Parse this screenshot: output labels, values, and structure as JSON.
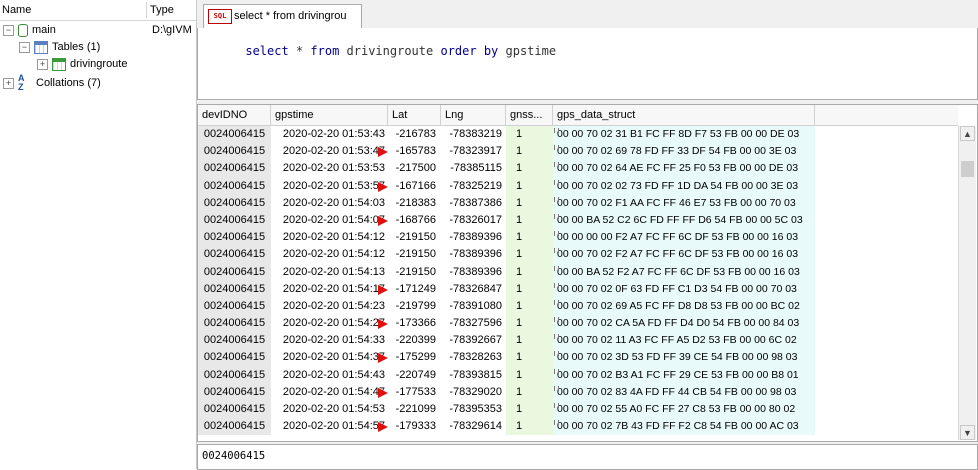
{
  "tree": {
    "header": {
      "name": "Name",
      "type": "Type"
    },
    "items": [
      {
        "label": "main",
        "type": "D:\\gIVM"
      },
      {
        "label": "Tables (1)"
      },
      {
        "label": "drivingroute"
      },
      {
        "label": "Collations (7)"
      }
    ]
  },
  "tab": {
    "label": "select * from drivingrou",
    "icon": "sql-icon"
  },
  "editor": {
    "tokens": [
      {
        "t": "select",
        "kw": true
      },
      {
        "t": " * ",
        "kw": false
      },
      {
        "t": "from",
        "kw": true
      },
      {
        "t": " drivingroute ",
        "kw": false
      },
      {
        "t": "order",
        "kw": true
      },
      {
        "t": " ",
        "kw": false
      },
      {
        "t": "by",
        "kw": true
      },
      {
        "t": " gpstime",
        "kw": false
      }
    ]
  },
  "grid": {
    "columns": [
      "devIDNO",
      "gpstime",
      "Lat",
      "Lng",
      "gnss...",
      "gps_data_struct"
    ],
    "rows": [
      {
        "dev": "0024006415",
        "time": "2020-02-20 01:53:43",
        "lat": "-216783",
        "lng": "-78383219",
        "gnss": "1",
        "data": "00 00 70 02 31 B1 FC FF 8D F7 53 FB 00 00 DE 03",
        "arrow": false
      },
      {
        "dev": "0024006415",
        "time": "2020-02-20 01:53:47",
        "lat": "-165783",
        "lng": "-78323917",
        "gnss": "1",
        "data": "00 00 70 02 69 78 FD FF 33 DF 54 FB 00 00 3E 03",
        "arrow": true
      },
      {
        "dev": "0024006415",
        "time": "2020-02-20 01:53:53",
        "lat": "-217500",
        "lng": "-78385115",
        "gnss": "1",
        "data": "00 00 70 02 64 AE FC FF 25 F0 53 FB 00 00 DE 03",
        "arrow": false
      },
      {
        "dev": "0024006415",
        "time": "2020-02-20 01:53:57",
        "lat": "-167166",
        "lng": "-78325219",
        "gnss": "1",
        "data": "00 00 70 02 02 73 FD FF 1D DA 54 FB 00 00 3E 03",
        "arrow": true
      },
      {
        "dev": "0024006415",
        "time": "2020-02-20 01:54:03",
        "lat": "-218383",
        "lng": "-78387386",
        "gnss": "1",
        "data": "00 00 70 02 F1 AA FC FF 46 E7 53 FB 00 00 70 03",
        "arrow": false
      },
      {
        "dev": "0024006415",
        "time": "2020-02-20 01:54:07",
        "lat": "-168766",
        "lng": "-78326017",
        "gnss": "1",
        "data": "00 00 BA 52 C2 6C FD FF FF D6 54 FB 00 00 5C 03",
        "arrow": true
      },
      {
        "dev": "0024006415",
        "time": "2020-02-20 01:54:12",
        "lat": "-219150",
        "lng": "-78389396",
        "gnss": "1",
        "data": "00 00 00 00 F2 A7 FC FF 6C DF 53 FB 00 00 16 03",
        "arrow": false
      },
      {
        "dev": "0024006415",
        "time": "2020-02-20 01:54:12",
        "lat": "-219150",
        "lng": "-78389396",
        "gnss": "1",
        "data": "00 00 70 02 F2 A7 FC FF 6C DF 53 FB 00 00 16 03",
        "arrow": false
      },
      {
        "dev": "0024006415",
        "time": "2020-02-20 01:54:13",
        "lat": "-219150",
        "lng": "-78389396",
        "gnss": "1",
        "data": "00 00 BA 52 F2 A7 FC FF 6C DF 53 FB 00 00 16 03",
        "arrow": false
      },
      {
        "dev": "0024006415",
        "time": "2020-02-20 01:54:17",
        "lat": "-171249",
        "lng": "-78326847",
        "gnss": "1",
        "data": "00 00 70 02 0F 63 FD FF C1 D3 54 FB 00 00 70 03",
        "arrow": true
      },
      {
        "dev": "0024006415",
        "time": "2020-02-20 01:54:23",
        "lat": "-219799",
        "lng": "-78391080",
        "gnss": "1",
        "data": "00 00 70 02 69 A5 FC FF D8 D8 53 FB 00 00 BC 02",
        "arrow": false
      },
      {
        "dev": "0024006415",
        "time": "2020-02-20 01:54:27",
        "lat": "-173366",
        "lng": "-78327596",
        "gnss": "1",
        "data": "00 00 70 02 CA 5A FD FF D4 D0 54 FB 00 00 84 03",
        "arrow": true
      },
      {
        "dev": "0024006415",
        "time": "2020-02-20 01:54:33",
        "lat": "-220399",
        "lng": "-78392667",
        "gnss": "1",
        "data": "00 00 70 02 11 A3 FC FF A5 D2 53 FB 00 00 6C 02",
        "arrow": false
      },
      {
        "dev": "0024006415",
        "time": "2020-02-20 01:54:37",
        "lat": "-175299",
        "lng": "-78328263",
        "gnss": "1",
        "data": "00 00 70 02 3D 53 FD FF 39 CE 54 FB 00 00 98 03",
        "arrow": true
      },
      {
        "dev": "0024006415",
        "time": "2020-02-20 01:54:43",
        "lat": "-220749",
        "lng": "-78393815",
        "gnss": "1",
        "data": "00 00 70 02 B3 A1 FC FF 29 CE 53 FB 00 00 B8 01",
        "arrow": false
      },
      {
        "dev": "0024006415",
        "time": "2020-02-20 01:54:47",
        "lat": "-177533",
        "lng": "-78329020",
        "gnss": "1",
        "data": "00 00 70 02 83 4A FD FF 44 CB 54 FB 00 00 98 03",
        "arrow": true
      },
      {
        "dev": "0024006415",
        "time": "2020-02-20 01:54:53",
        "lat": "-221099",
        "lng": "-78395353",
        "gnss": "1",
        "data": "00 00 70 02 55 A0 FC FF 27 C8 53 FB 00 00 80 02",
        "arrow": false
      },
      {
        "dev": "0024006415",
        "time": "2020-02-20 01:54:57",
        "lat": "-179333",
        "lng": "-78329614",
        "gnss": "1",
        "data": "00 00 70 02 7B 43 FD FF F2 C8 54 FB 00 00 AC 03",
        "arrow": true
      }
    ]
  },
  "status": {
    "value": "0024006415"
  },
  "colors": {
    "arrow": "#e01010",
    "keyword": "#00008b",
    "gnss_bg": "#eaf8e0",
    "data_bg": "#e8fafa"
  }
}
